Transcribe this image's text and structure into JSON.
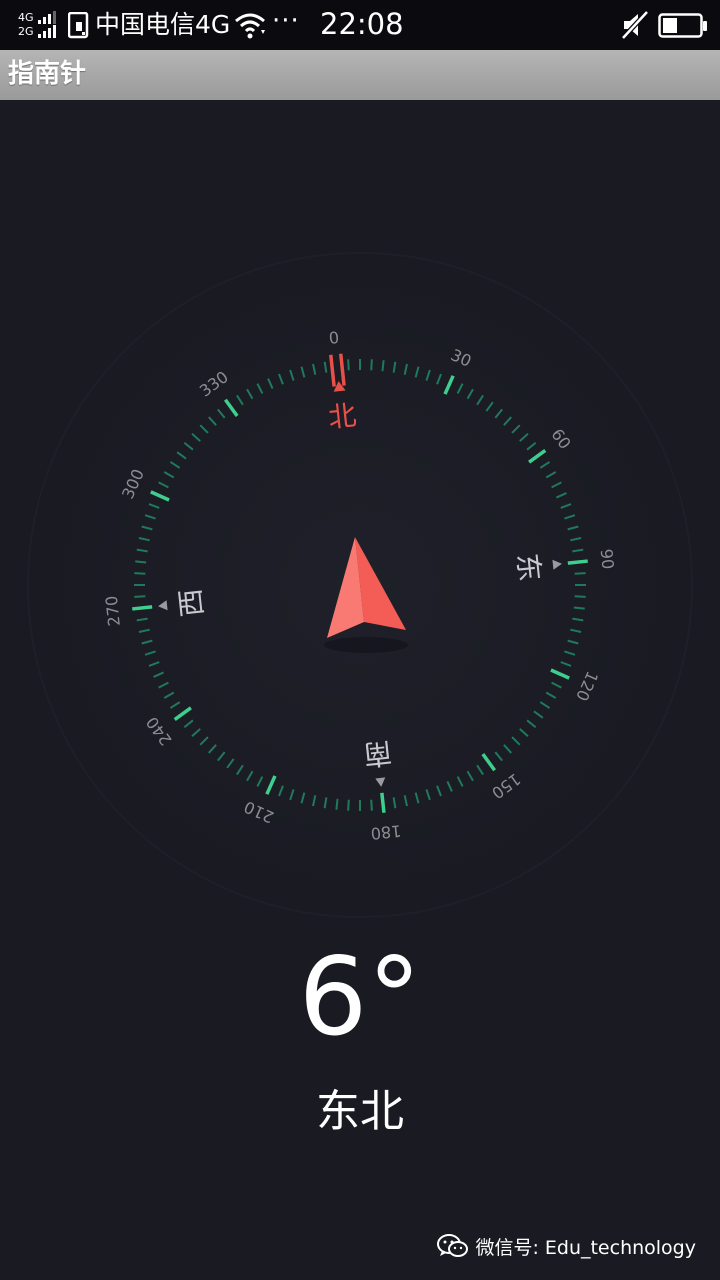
{
  "status_bar": {
    "network_upper": "4G",
    "network_lower": "2G",
    "carrier": "中国电信4G",
    "overflow": "···",
    "time": "22:08"
  },
  "app": {
    "title": "指南针"
  },
  "compass": {
    "degree_labels": [
      "0",
      "30",
      "60",
      "90",
      "120",
      "150",
      "180",
      "210",
      "240",
      "270",
      "300",
      "330"
    ],
    "cardinals": {
      "north": "北",
      "east": "东",
      "south": "南",
      "west": "西"
    },
    "rotation_deg": -6,
    "north_color": "#e8504a",
    "accent_color": "#3ecf8e",
    "tick_color": "#1f7a5c",
    "arrow_color": "#f45d55"
  },
  "heading": {
    "degrees": "6°",
    "direction": "东北"
  },
  "watermark": {
    "text": "微信号: Edu_technology"
  }
}
